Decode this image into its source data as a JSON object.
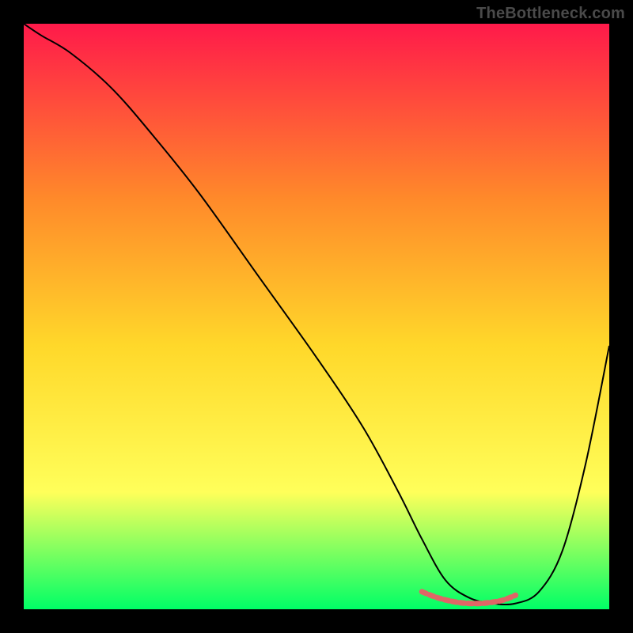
{
  "watermark": "TheBottleneck.com",
  "chart_data": {
    "type": "line",
    "title": "",
    "xlabel": "",
    "ylabel": "",
    "xlim": [
      0,
      100
    ],
    "ylim": [
      0,
      100
    ],
    "background_gradient": {
      "top": "#ff1a4a",
      "upper_mid": "#ff8a2a",
      "mid": "#ffd82a",
      "lower_mid": "#ffff5a",
      "bottom": "#00ff66"
    },
    "series": [
      {
        "name": "main-curve",
        "color": "#000000",
        "stroke_width": 2,
        "x": [
          0,
          3,
          8,
          15,
          22,
          30,
          40,
          50,
          58,
          64,
          68,
          72,
          76,
          80,
          84,
          88,
          92,
          96,
          100
        ],
        "y": [
          100,
          98,
          95,
          89,
          81,
          71,
          57,
          43,
          31,
          20,
          12,
          5,
          2,
          1,
          1,
          3,
          10,
          25,
          45
        ]
      },
      {
        "name": "marker-band",
        "color": "#e06666",
        "stroke_width": 7,
        "x": [
          68,
          70,
          72,
          74,
          76,
          78,
          80,
          82,
          84
        ],
        "y": [
          3.0,
          2.2,
          1.6,
          1.2,
          1.0,
          1.0,
          1.2,
          1.6,
          2.4
        ]
      }
    ]
  }
}
